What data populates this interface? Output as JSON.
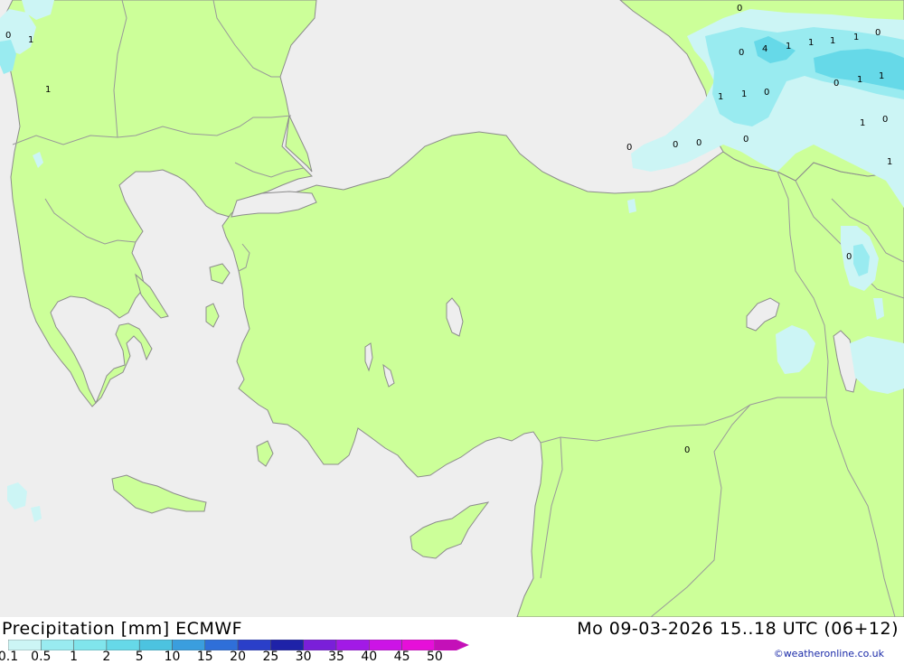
{
  "map": {
    "precip_labels": [
      {
        "id": "p1",
        "text": "0"
      },
      {
        "id": "p2",
        "text": "1"
      },
      {
        "id": "p3",
        "text": "1"
      },
      {
        "id": "p4",
        "text": "0"
      },
      {
        "id": "p5",
        "text": "0"
      },
      {
        "id": "p6",
        "text": "4"
      },
      {
        "id": "p7",
        "text": "1"
      },
      {
        "id": "p8",
        "text": "1"
      },
      {
        "id": "p9",
        "text": "1"
      },
      {
        "id": "p10",
        "text": "1"
      },
      {
        "id": "p11",
        "text": "0"
      },
      {
        "id": "p12",
        "text": "0"
      },
      {
        "id": "p13",
        "text": "1"
      },
      {
        "id": "p14",
        "text": "1"
      },
      {
        "id": "p15",
        "text": "1"
      },
      {
        "id": "p16",
        "text": "1"
      },
      {
        "id": "p17",
        "text": "0"
      },
      {
        "id": "p18",
        "text": "1"
      },
      {
        "id": "p19",
        "text": "0"
      },
      {
        "id": "p20",
        "text": "0"
      },
      {
        "id": "p21",
        "text": "0"
      },
      {
        "id": "p22",
        "text": "0"
      },
      {
        "id": "p23",
        "text": "0"
      },
      {
        "id": "p24",
        "text": "1"
      },
      {
        "id": "p25",
        "text": "0"
      },
      {
        "id": "p26",
        "text": "0"
      }
    ],
    "colors": {
      "land": "#ccff99",
      "sea": "#eeeeee",
      "border": "#999999",
      "coast": "#8c8c8c",
      "precip_light": "#ccf5f5",
      "precip_mid": "#99ebf0",
      "precip_heavy": "#66d9e8"
    }
  },
  "footer": {
    "title": "Precipitation [mm] ECMWF",
    "datetime": "Mo 09-03-2026 15..18 UTC (06+12)",
    "credit": "©weatheronline.co.uk",
    "legend_values": [
      "0.1",
      "0.5",
      "1",
      "2",
      "5",
      "10",
      "15",
      "20",
      "25",
      "30",
      "35",
      "40",
      "45",
      "50"
    ],
    "legend_colors": [
      "#ccf5f5",
      "#99ebf0",
      "#80e5ec",
      "#66d9e8",
      "#4cc3e0",
      "#3a9ede",
      "#2f6fd9",
      "#2a3fc9",
      "#1e22a8",
      "#7a1fd9",
      "#a21ae6",
      "#cc14e6",
      "#e60fd9",
      "#c410b8"
    ]
  }
}
